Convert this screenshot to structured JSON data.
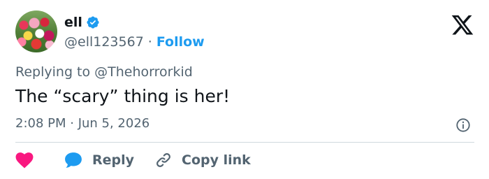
{
  "author": {
    "display_name": "ell",
    "handle": "@ell123567",
    "separator": "·",
    "follow_label": "Follow",
    "verified": true
  },
  "tweet": {
    "reply_prefix": "Replying to ",
    "reply_to": "@Thehorrorkid",
    "text": "The “scary” thing is her!",
    "timestamp": "2:08 PM · Jun 5, 2026"
  },
  "actions": {
    "reply_label": "Reply",
    "copy_link_label": "Copy link"
  },
  "colors": {
    "accent": "#1d9bf0",
    "heart": "#f91880",
    "text_primary": "#0f1419",
    "text_secondary": "#536471",
    "divider": "#cfd9de"
  },
  "icons": [
    "verified-badge-icon",
    "x-logo-icon",
    "info-icon",
    "heart-icon",
    "reply-bubble-icon",
    "link-icon"
  ]
}
